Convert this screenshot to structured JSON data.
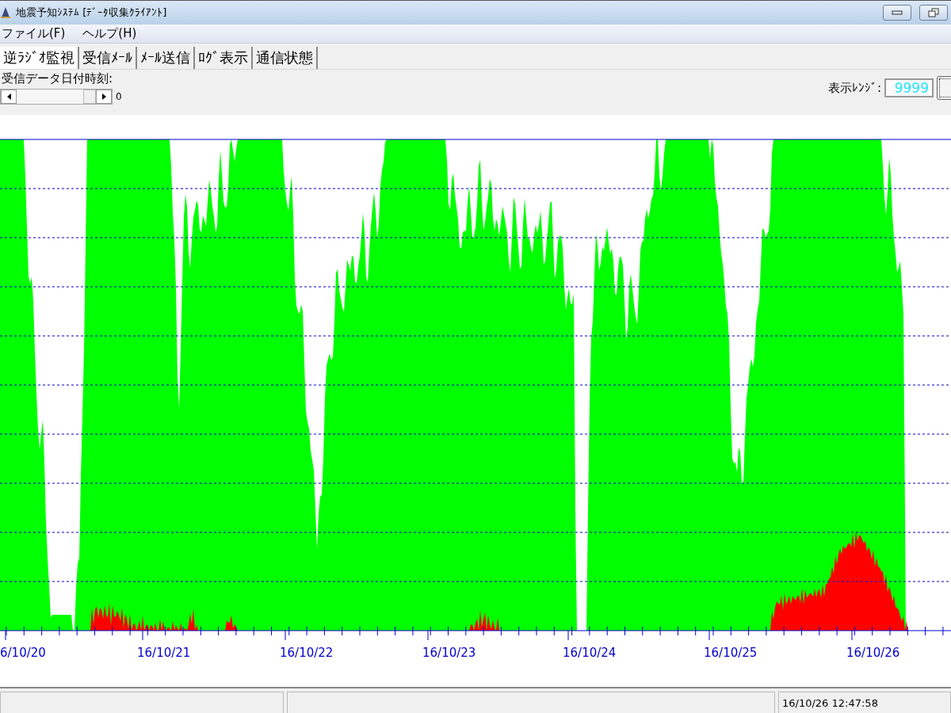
{
  "window": {
    "title": "地震予知ｼｽﾃﾑ [ﾃﾞｰﾀ収集ｸﾗｲｱﾝﾄ]"
  },
  "menu": [
    "ファイル(F)",
    "ヘルプ(H)"
  ],
  "tabs": [
    {
      "label": "逆ﾗｼﾞｵ監視",
      "selected": true
    },
    {
      "label": "受信ﾒｰﾙ",
      "selected": false
    },
    {
      "label": "ﾒｰﾙ送信",
      "selected": false
    },
    {
      "label": "ﾛｸﾞ表示",
      "selected": false
    },
    {
      "label": "通信状態",
      "selected": false
    }
  ],
  "received_time": {
    "label": "受信データ日付時刻:",
    "value": "0",
    "level": 1.0
  },
  "display_range": {
    "label": "表示ﾚﾝｼﾞ:",
    "value": "9999"
  },
  "chart": {
    "dates": [
      "6/10/20",
      "16/10/21",
      "16/10/22",
      "16/10/23",
      "16/10/24",
      "16/10/25",
      "16/10/26"
    ]
  },
  "status_bar": {
    "timestamp": "16/10/26 12:47:58"
  }
}
